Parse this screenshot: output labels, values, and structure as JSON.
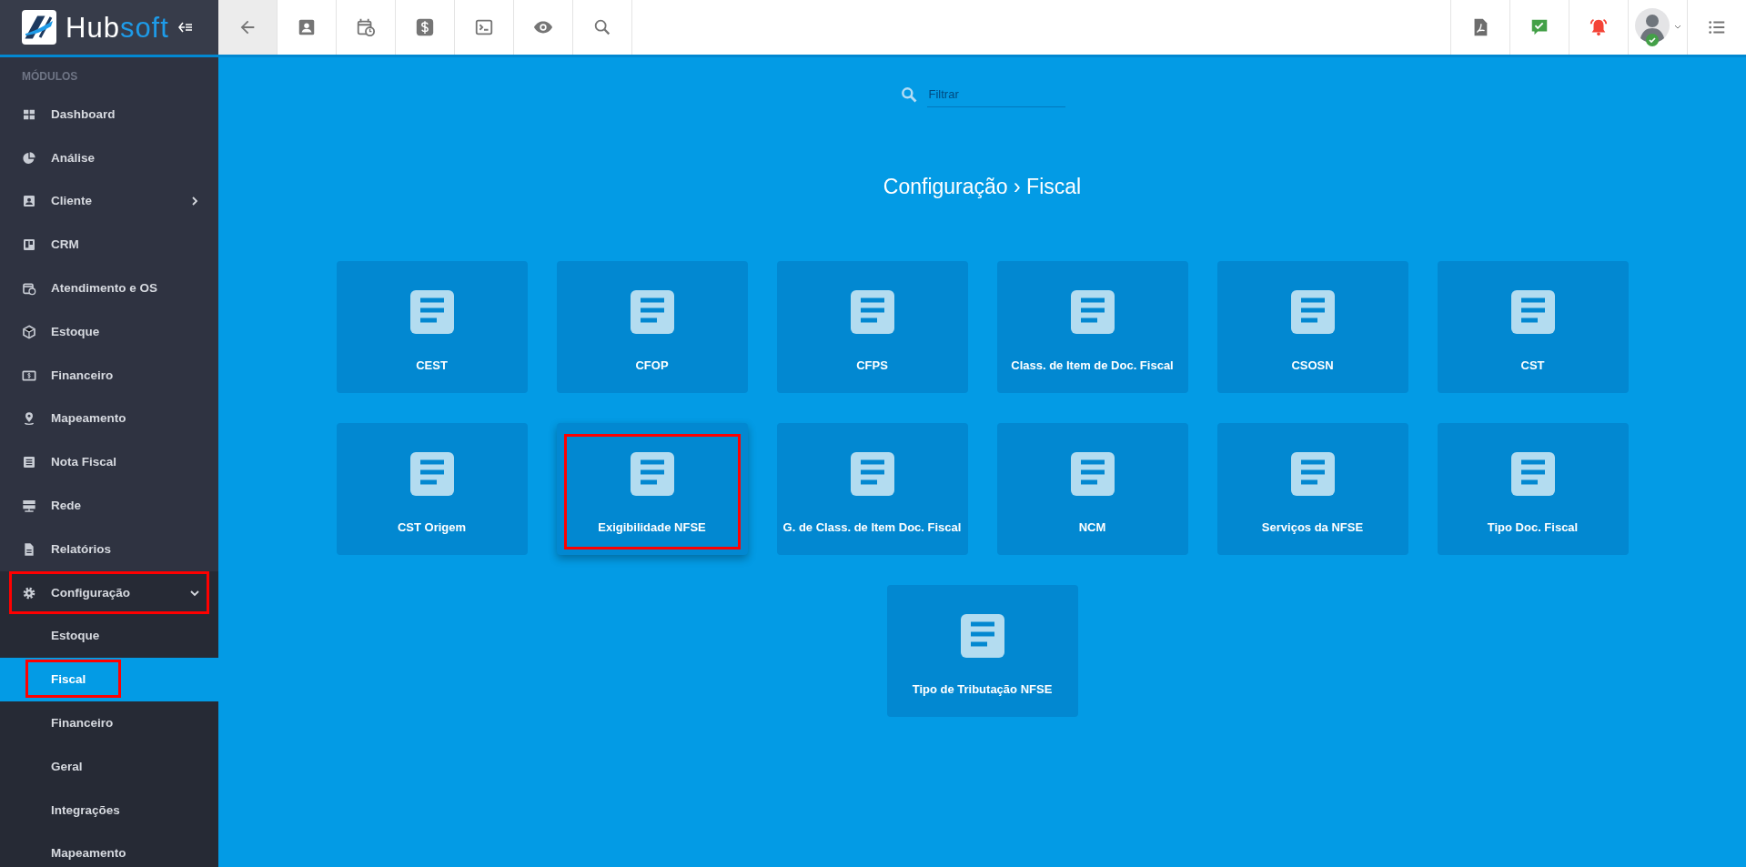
{
  "logo": {
    "text_main": "Hub",
    "text_accent": "soft"
  },
  "sidebar": {
    "section_label": "MÓDULOS",
    "items": [
      {
        "label": "Dashboard"
      },
      {
        "label": "Análise"
      },
      {
        "label": "Cliente",
        "expanded": false
      },
      {
        "label": "CRM"
      },
      {
        "label": "Atendimento e OS"
      },
      {
        "label": "Estoque"
      },
      {
        "label": "Financeiro"
      },
      {
        "label": "Mapeamento"
      },
      {
        "label": "Nota Fiscal"
      },
      {
        "label": "Rede"
      },
      {
        "label": "Relatórios"
      },
      {
        "label": "Configuração",
        "expanded": true,
        "highlighted": true,
        "children": [
          {
            "label": "Estoque",
            "selected": false,
            "highlighted": false
          },
          {
            "label": "Fiscal",
            "selected": true,
            "highlighted": true
          },
          {
            "label": "Financeiro",
            "selected": false,
            "highlighted": false
          },
          {
            "label": "Geral",
            "selected": false,
            "highlighted": false
          },
          {
            "label": "Integrações",
            "selected": false,
            "highlighted": false
          },
          {
            "label": "Mapeamento",
            "selected": false,
            "highlighted": false
          }
        ]
      }
    ]
  },
  "filter": {
    "placeholder": "Filtrar"
  },
  "page_title": "Configuração › Fiscal",
  "tiles": [
    {
      "label": "CEST",
      "highlighted": false
    },
    {
      "label": "CFOP",
      "highlighted": false
    },
    {
      "label": "CFPS",
      "highlighted": false
    },
    {
      "label": "Class. de Item de Doc. Fiscal",
      "highlighted": false
    },
    {
      "label": "CSOSN",
      "highlighted": false
    },
    {
      "label": "CST",
      "highlighted": false
    },
    {
      "label": "CST Origem",
      "highlighted": false
    },
    {
      "label": "Exigibilidade NFSE",
      "highlighted": true
    },
    {
      "label": "G. de Class. de Item Doc. Fiscal",
      "highlighted": false
    },
    {
      "label": "NCM",
      "highlighted": false
    },
    {
      "label": "Serviços da NFSE",
      "highlighted": false
    },
    {
      "label": "Tipo Doc. Fiscal",
      "highlighted": false
    },
    {
      "label": "Tipo de Tributação NFSE",
      "highlighted": false
    }
  ]
}
